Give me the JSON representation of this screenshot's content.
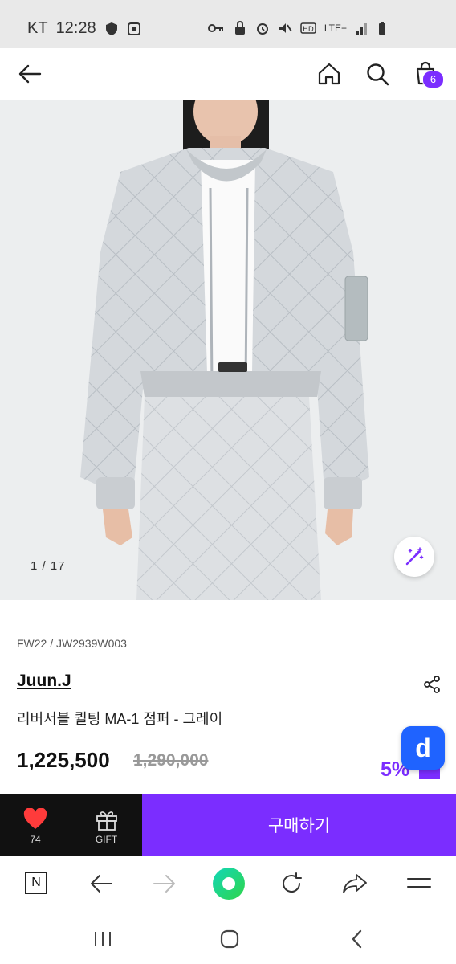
{
  "status": {
    "carrier": "KT",
    "time": "12:28",
    "network": "LTE+"
  },
  "header": {
    "cart_count": "6"
  },
  "gallery": {
    "counter": "1 / 17"
  },
  "product": {
    "season_code": "FW22 / JW2939W003",
    "brand": "Juun.J",
    "name": "리버서블 퀼팅 MA-1 점퍼 - 그레이",
    "price": "1,225,500",
    "original_price": "1,290,000",
    "discount": "5%",
    "d_label": "d"
  },
  "bottom_bar": {
    "like_count": "74",
    "gift_label": "GIFT",
    "buy_label": "구매하기"
  },
  "browser": {
    "n_label": "N"
  },
  "colors": {
    "accent": "#7b2dff",
    "d_button": "#1f63ff",
    "like_heart": "#ff3b3b"
  }
}
